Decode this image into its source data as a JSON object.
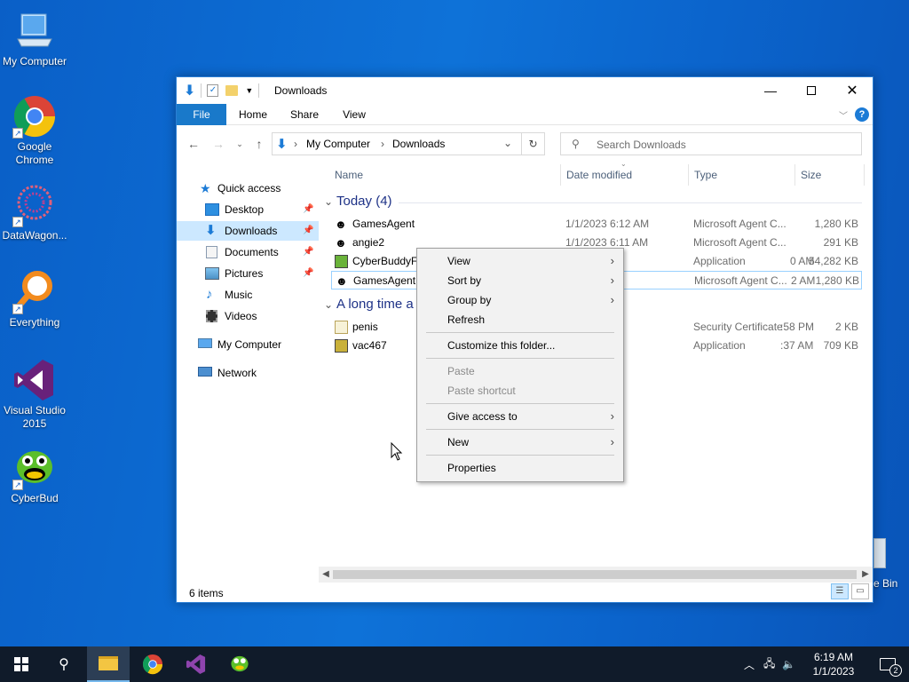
{
  "desktop": {
    "icons": [
      {
        "label": "My Computer"
      },
      {
        "label": "Google Chrome"
      },
      {
        "label": "DataWagon..."
      },
      {
        "label": "Everything"
      },
      {
        "label": "Visual Studio 2015"
      },
      {
        "label": "CyberBud"
      }
    ],
    "recycle_label": "e Bin"
  },
  "window": {
    "title": "Downloads",
    "ribbon_tabs": [
      "File",
      "Home",
      "Share",
      "View"
    ],
    "address": {
      "parts": [
        "My Computer",
        "Downloads"
      ]
    },
    "search_placeholder": "Search Downloads",
    "nav": [
      {
        "label": "Quick access"
      },
      {
        "label": "Desktop"
      },
      {
        "label": "Downloads"
      },
      {
        "label": "Documents"
      },
      {
        "label": "Pictures"
      },
      {
        "label": "Music"
      },
      {
        "label": "Videos"
      },
      {
        "label": "My Computer"
      },
      {
        "label": "Network"
      }
    ],
    "columns": [
      "Name",
      "Date modified",
      "Type",
      "Size"
    ],
    "groups": [
      {
        "label": "Today (4)",
        "files": [
          {
            "name": "GamesAgent",
            "date": "1/1/2023 6:12 AM",
            "type": "Microsoft Agent C...",
            "size": "1,280 KB"
          },
          {
            "name": "angie2",
            "date": "1/1/2023 6:11 AM",
            "type": "Microsoft Agent C...",
            "size": "291 KB"
          },
          {
            "name": "CyberBuddyF",
            "date": "0 AM",
            "type": "Application",
            "size": "54,282 KB"
          },
          {
            "name": "GamesAgent",
            "date": "2 AM",
            "type": "Microsoft Agent C...",
            "size": "1,280 KB"
          }
        ]
      },
      {
        "label": "A long time a",
        "files": [
          {
            "name": "penis",
            "date": ":58 PM",
            "type": "Security Certificate",
            "size": "2 KB"
          },
          {
            "name": "vac467",
            "date": ":37 AM",
            "type": "Application",
            "size": "709 KB"
          }
        ]
      }
    ],
    "status": "6 items"
  },
  "context_menu": {
    "items": [
      {
        "label": "View"
      },
      {
        "label": "Sort by"
      },
      {
        "label": "Group by"
      },
      {
        "label": "Refresh"
      },
      {
        "label": "Customize this folder..."
      },
      {
        "label": "Paste"
      },
      {
        "label": "Paste shortcut"
      },
      {
        "label": "Give access to"
      },
      {
        "label": "New"
      },
      {
        "label": "Properties"
      }
    ]
  },
  "taskbar": {
    "time": "6:19 AM",
    "date": "1/1/2023",
    "notification_count": "2"
  }
}
